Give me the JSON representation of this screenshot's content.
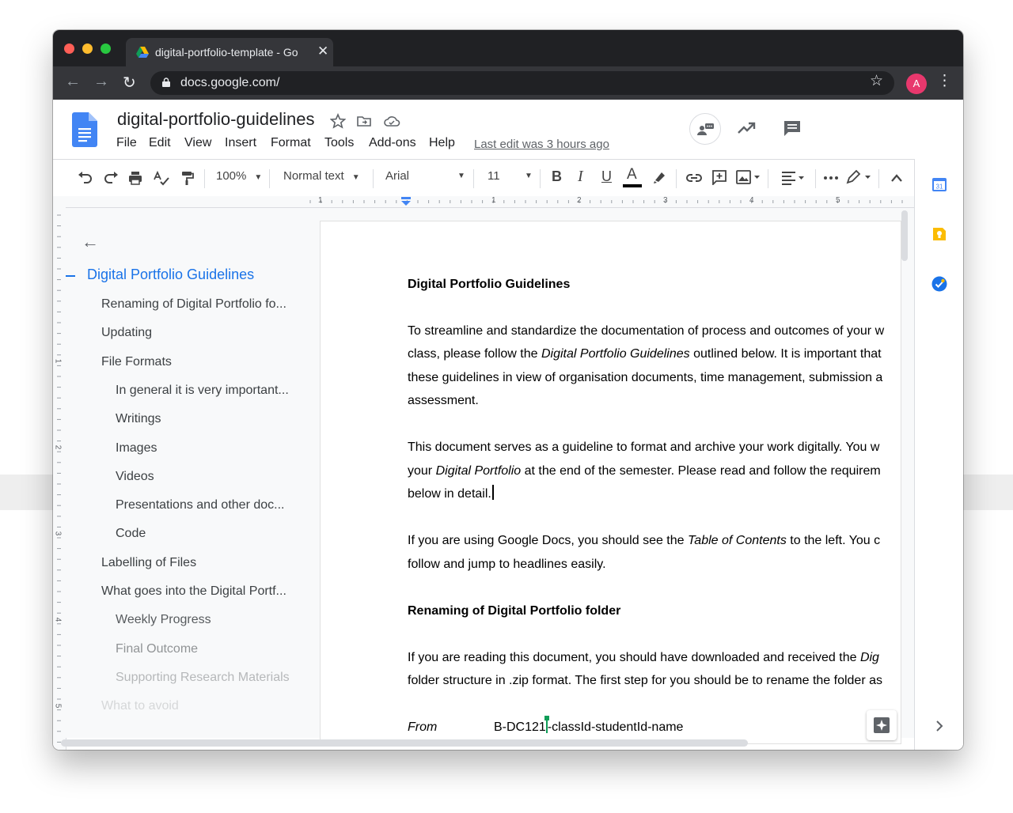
{
  "browser": {
    "tab_title": "digital-portfolio-template - Go",
    "tab_close": "✕",
    "url": "docs.google.com/",
    "avatar_letter": "A",
    "back_icon": "←",
    "forward_icon": "→",
    "reload_icon": "↻",
    "star_icon": "☆",
    "menu_icon": "⋮"
  },
  "docs": {
    "title": "digital-portfolio-guidelines",
    "menu": [
      "File",
      "Edit",
      "View",
      "Insert",
      "Format",
      "Tools",
      "Add-ons",
      "Help"
    ],
    "last_edit": "Last edit was 3 hours ago"
  },
  "toolbar": {
    "zoom": "100%",
    "style": "Normal text",
    "font": "Arial",
    "size": "11",
    "bold": "B",
    "italic": "I",
    "underline": "U",
    "text_color": "A"
  },
  "ruler": {
    "labels": [
      "1",
      "1",
      "2",
      "3",
      "4",
      "5"
    ],
    "vlabels": [
      "1",
      "2",
      "3",
      "4",
      "5"
    ]
  },
  "outline": {
    "back_icon": "←",
    "title": "Digital Portfolio Guidelines",
    "items": [
      {
        "text": "Renaming of Digital Portfolio fo...",
        "level": 1
      },
      {
        "text": "Updating",
        "level": 1
      },
      {
        "text": "File Formats",
        "level": 1
      },
      {
        "text": "In general it is very important...",
        "level": 2
      },
      {
        "text": "Writings",
        "level": 2
      },
      {
        "text": "Images",
        "level": 2
      },
      {
        "text": "Videos",
        "level": 2
      },
      {
        "text": "Presentations and other doc...",
        "level": 2
      },
      {
        "text": "Code",
        "level": 2
      },
      {
        "text": "Labelling of Files",
        "level": 1
      },
      {
        "text": "What goes into the Digital Portf...",
        "level": 1
      },
      {
        "text": "Weekly Progress",
        "level": 2
      },
      {
        "text": "Final Outcome",
        "level": 2
      },
      {
        "text": "Supporting Research Materials",
        "level": 2
      },
      {
        "text": "What to avoid",
        "level": 1
      }
    ]
  },
  "document": {
    "heading1": "Digital Portfolio Guidelines",
    "p1_l1": "To streamline and standardize the documentation of process and outcomes of your w",
    "p1_l2_a": "class, please follow the ",
    "p1_l2_i": "Digital Portfolio Guidelines",
    "p1_l2_b": " outlined below. It is important that",
    "p1_l3": "these guidelines in view of organisation documents, time management, submission a",
    "p1_l4": "assessment.",
    "p2_l1": "This document serves as a guideline to format and archive your work digitally. You w",
    "p2_l2_a": "your ",
    "p2_l2_i": "Digital Portfolio",
    "p2_l2_b": " at the end of the semester. Please read and follow the requirem",
    "p2_l3": "below in detail.",
    "p3_l1_a": "If you are using Google Docs, you should see the ",
    "p3_l1_i": "Table of Contents",
    "p3_l1_b": " to the left. You c",
    "p3_l2": "follow and jump to headlines easily.",
    "heading2": "Renaming of Digital Portfolio folder",
    "p4_l1_a": "If you are reading this document, you should have downloaded and received the ",
    "p4_l1_i": "Dig",
    "p4_l2": "folder structure in .zip format. The first step for you should be to rename the folder as",
    "from_label": "From",
    "from_value_a": "B-DC121",
    "from_value_b": "-classId-studentId-name"
  }
}
